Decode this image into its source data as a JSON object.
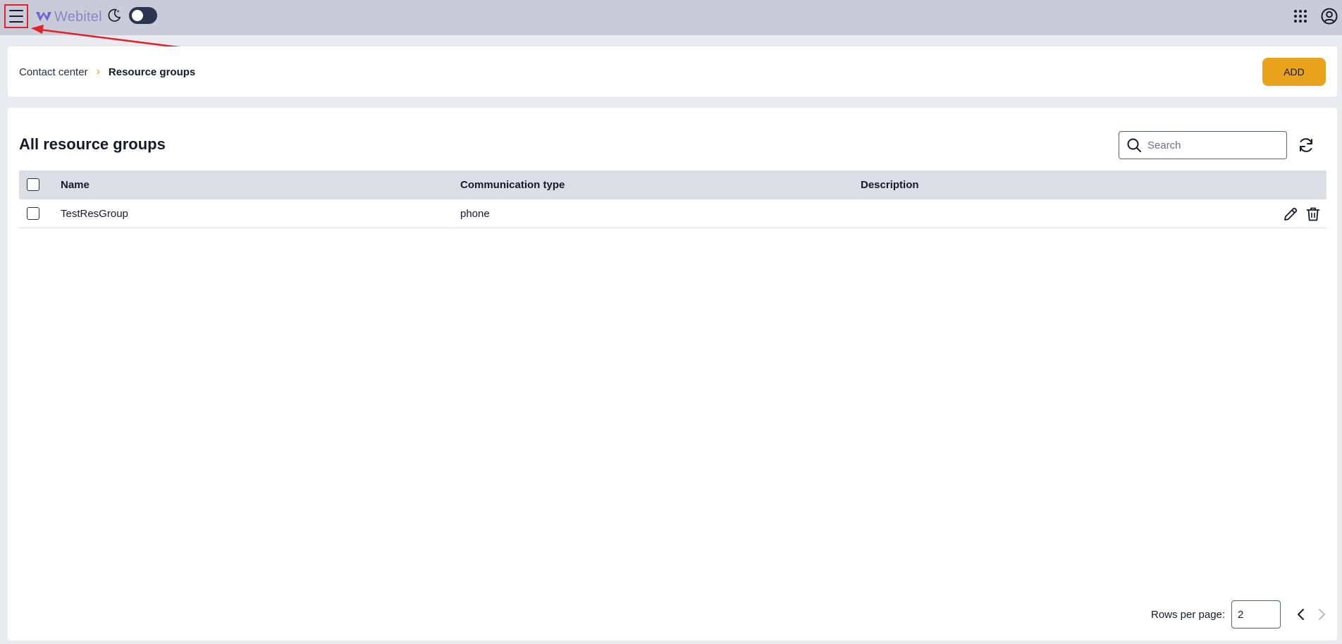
{
  "app": {
    "logo_text": "Webitel"
  },
  "breadcrumb": {
    "parent": "Contact center",
    "separator": "›",
    "current": "Resource groups"
  },
  "header": {
    "add_label": "ADD"
  },
  "main": {
    "title": "All resource groups",
    "search_placeholder": "Search",
    "table": {
      "columns": [
        "Name",
        "Communication type",
        "Description"
      ],
      "rows": [
        {
          "name": "TestResGroup",
          "communication_type": "phone",
          "description": ""
        }
      ]
    },
    "pagination": {
      "rows_label": "Rows per page:",
      "rows_value": "2"
    }
  },
  "colors": {
    "topbar": "#c9cbd9",
    "accent": "#e8a21b",
    "annotation": "#e0232a"
  },
  "icons": [
    "menu-icon",
    "webitel-logo-icon",
    "moon-icon",
    "apps-grid-icon",
    "account-icon",
    "search-icon",
    "refresh-icon",
    "edit-icon",
    "delete-icon",
    "chevron-left-icon",
    "chevron-right-icon"
  ]
}
